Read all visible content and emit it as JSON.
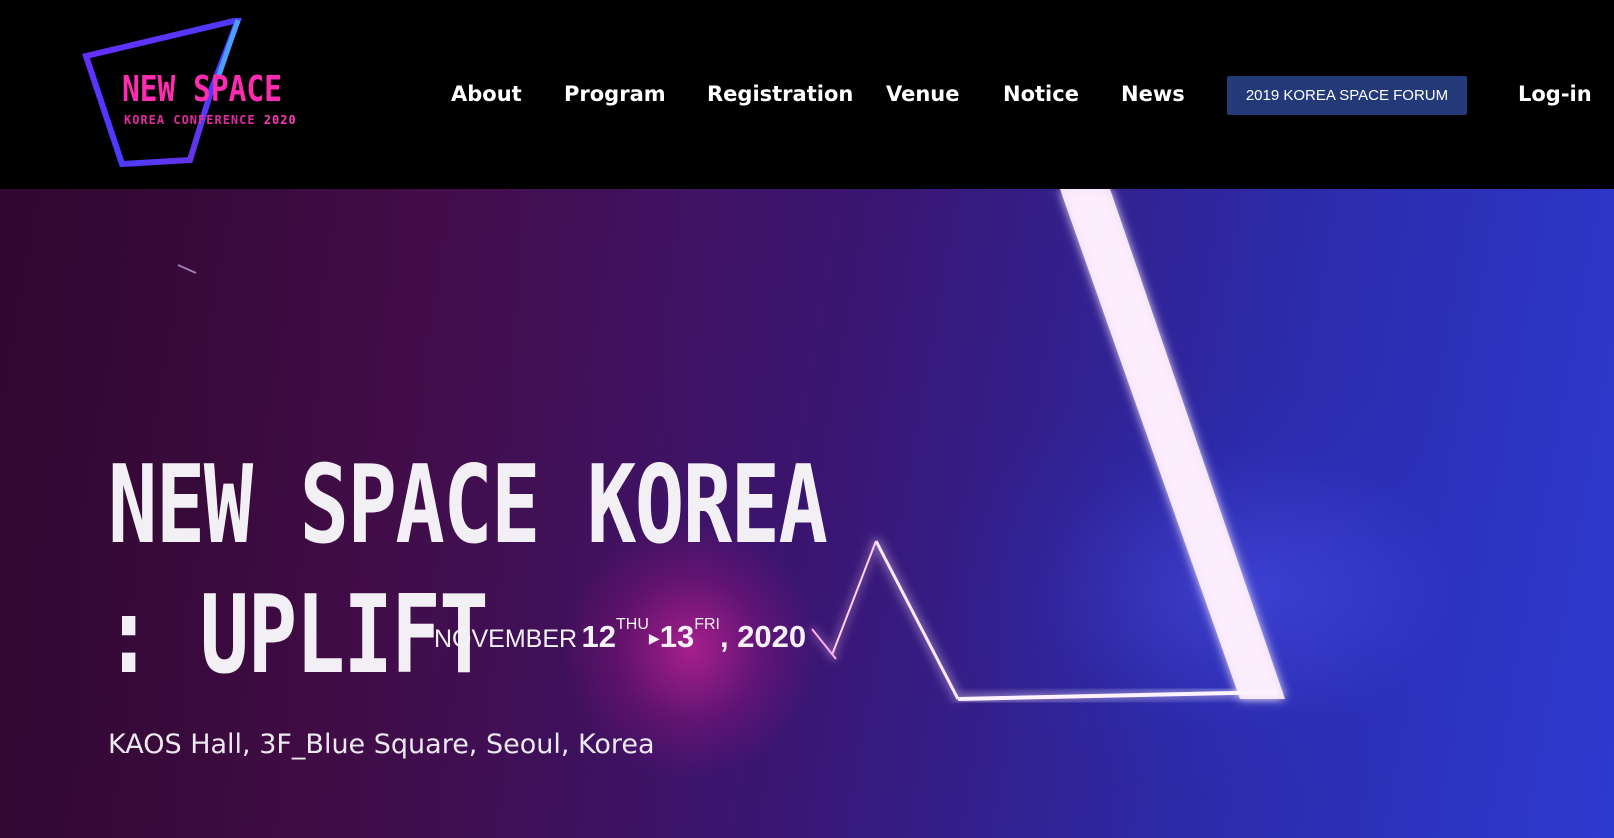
{
  "header": {
    "logo": {
      "title": "NEW SPACE",
      "subtitle": "KOREA CONFERENCE",
      "year": "2020"
    },
    "nav": [
      {
        "label": "About"
      },
      {
        "label": "Program"
      },
      {
        "label": "Registration"
      },
      {
        "label": "Venue"
      },
      {
        "label": "Notice"
      },
      {
        "label": "News"
      }
    ],
    "forum_button": "2019 KOREA SPACE FORUM",
    "login": "Log-in"
  },
  "hero": {
    "title": "NEW SPACE KOREA",
    "subtitle": ": UPLIFT",
    "date": {
      "month": "NOVEMBER",
      "start_day": "12",
      "start_dow": "THU",
      "end_day": "13",
      "end_dow": "FRI",
      "year": ", 2020"
    },
    "venue": "KAOS Hall, 3F_Blue Square, Seoul, Korea"
  },
  "colors": {
    "accent_pink": "#ff2bb0",
    "forum_button_bg": "#243a78",
    "header_bg": "#000000"
  }
}
